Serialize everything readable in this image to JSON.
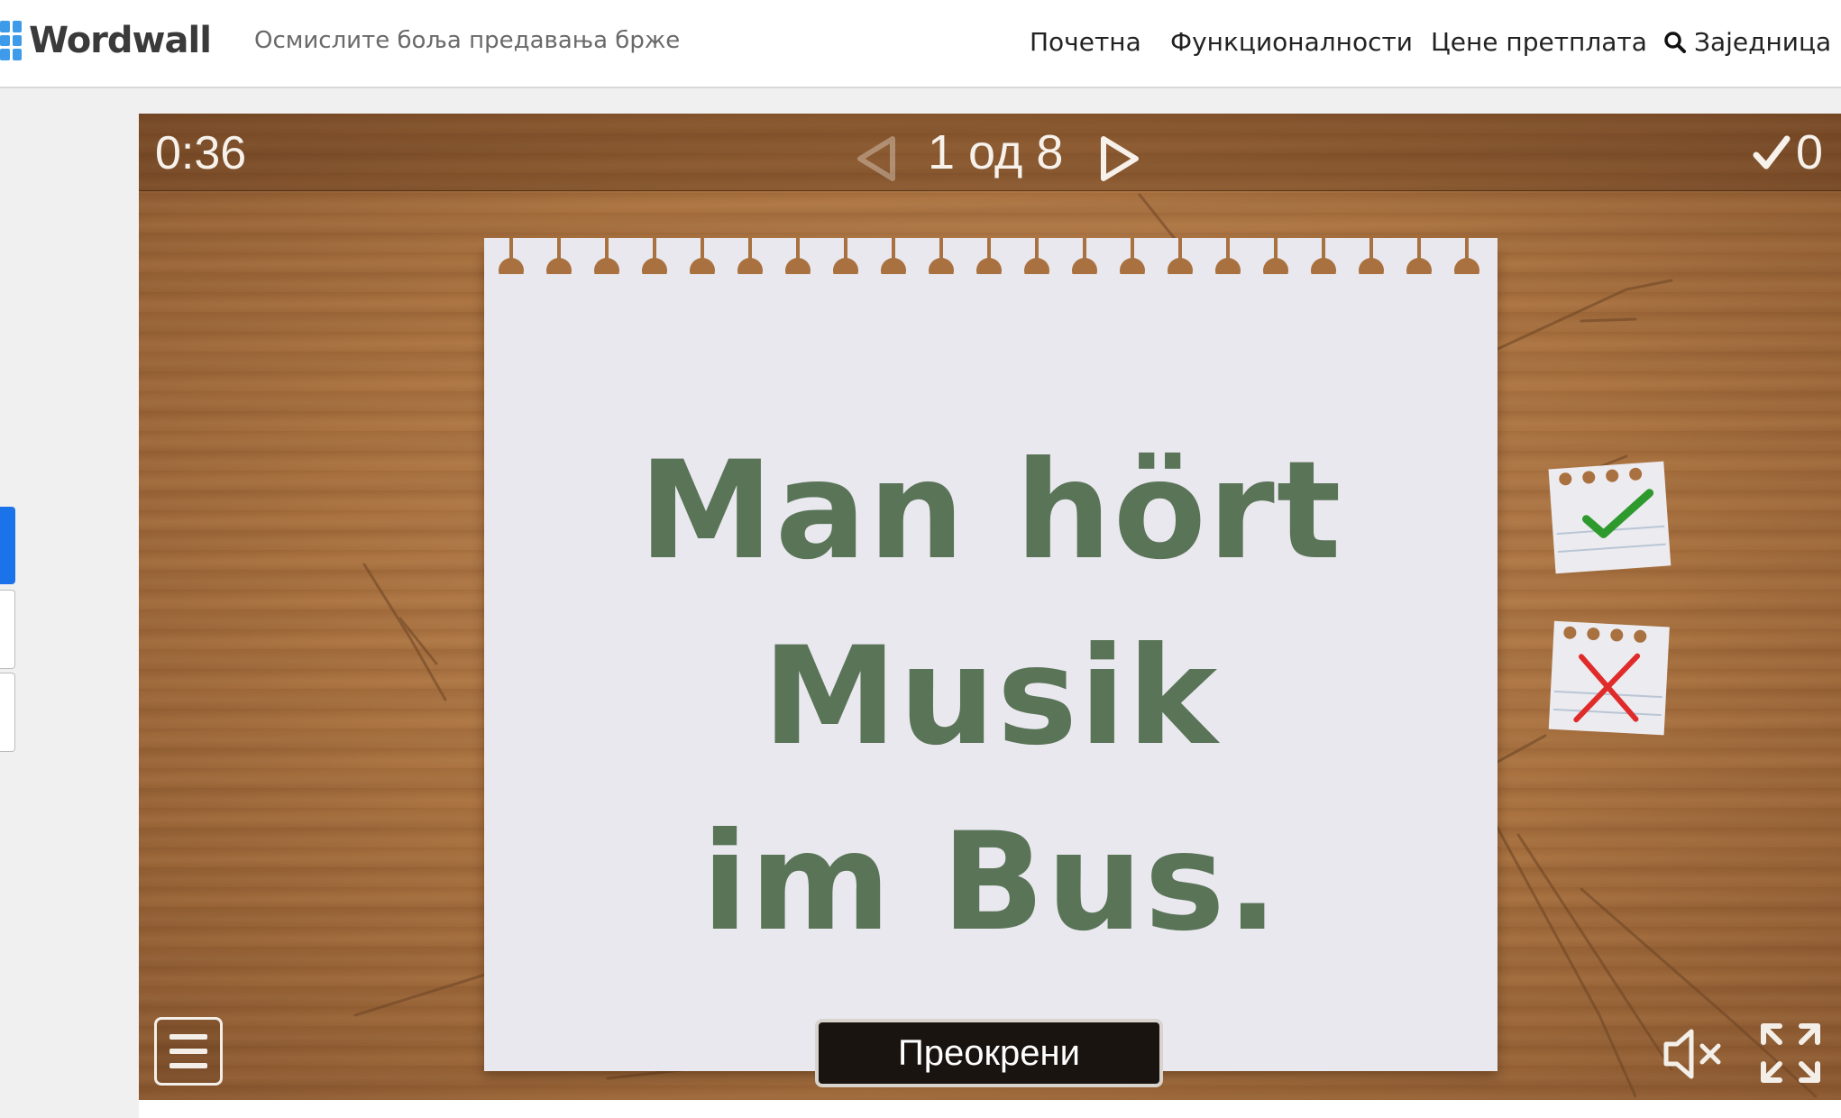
{
  "header": {
    "logo_text": "Wordwall",
    "tagline": "Осмислите боља предавања брже",
    "nav": {
      "home": "Почетна",
      "features": "Функционалности",
      "pricing": "Цене претплата",
      "community": "Заједница"
    }
  },
  "game": {
    "timer": "0:36",
    "counter": "1 од 8",
    "score": "0",
    "card_lines": [
      "Man hört",
      "Musik",
      "im Bus."
    ],
    "flip_label": "Преокрени"
  },
  "colors": {
    "brand_blue": "#3d9be9",
    "card_text": "#5a7458",
    "correct": "#2e9a2e",
    "wrong": "#e02b2b"
  },
  "icons": [
    "logo-grid-icon",
    "search-icon",
    "prev-arrow-icon",
    "next-arrow-icon",
    "checkmark-icon",
    "menu-icon",
    "mute-icon",
    "fullscreen-icon"
  ]
}
